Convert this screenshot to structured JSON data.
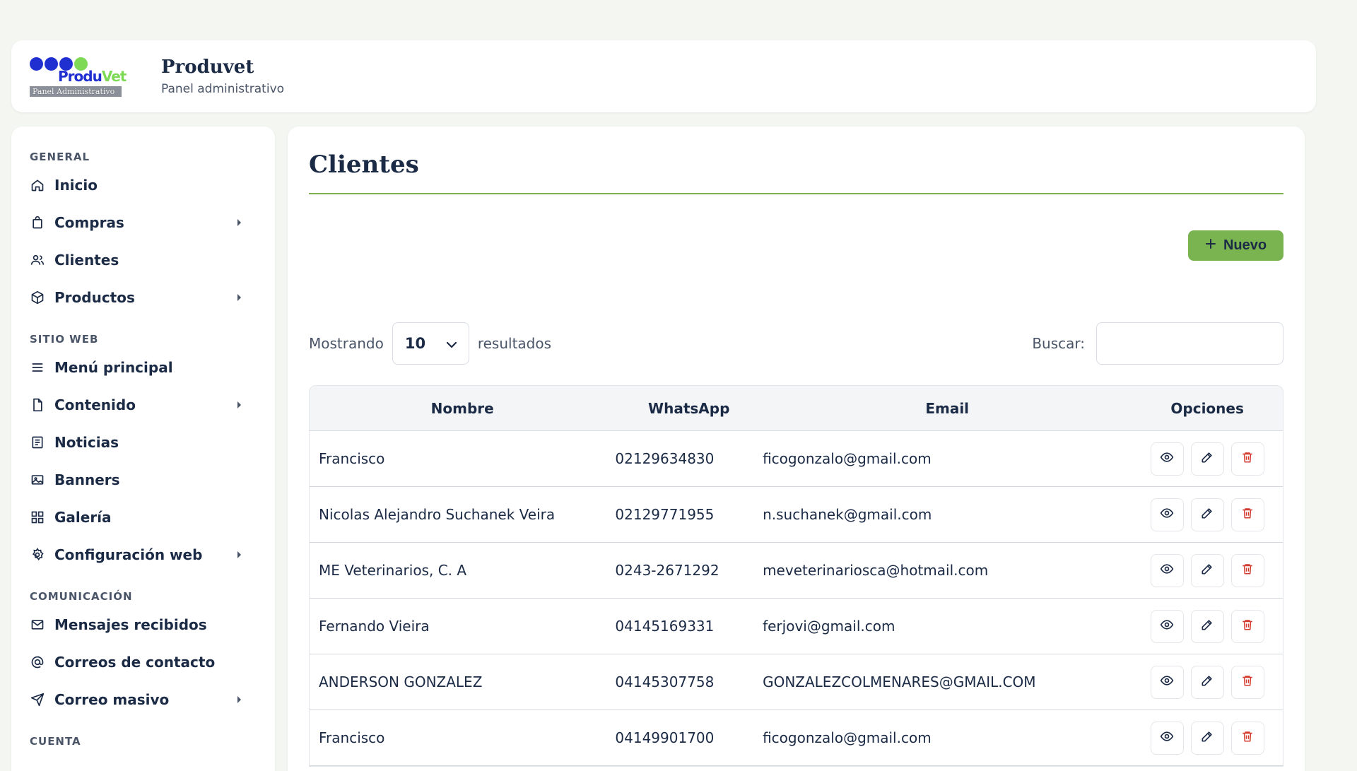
{
  "brand": {
    "title": "Produvet",
    "subtitle": "Panel administrativo",
    "logo_word_a": "Produ",
    "logo_word_b": "Vet",
    "logo_tagline": "Panel Administrativo",
    "colors": {
      "logo_blue": "#1f2fd0",
      "logo_green": "#7ed957",
      "accent": "#7ab450"
    }
  },
  "sidebar": {
    "sections": [
      {
        "label": "GENERAL",
        "items": [
          {
            "label": "Inicio",
            "icon": "home-icon",
            "submenu": false
          },
          {
            "label": "Compras",
            "icon": "bag-icon",
            "submenu": true
          },
          {
            "label": "Clientes",
            "icon": "users-icon",
            "submenu": false
          },
          {
            "label": "Productos",
            "icon": "box-icon",
            "submenu": true
          }
        ]
      },
      {
        "label": "SITIO WEB",
        "items": [
          {
            "label": "Menú principal",
            "icon": "menu-icon",
            "submenu": false
          },
          {
            "label": "Contenido",
            "icon": "file-icon",
            "submenu": true
          },
          {
            "label": "Noticias",
            "icon": "news-icon",
            "submenu": false
          },
          {
            "label": "Banners",
            "icon": "image-icon",
            "submenu": false
          },
          {
            "label": "Galería",
            "icon": "grid-icon",
            "submenu": false
          },
          {
            "label": "Configuración web",
            "icon": "gear-icon",
            "submenu": true
          }
        ]
      },
      {
        "label": "COMUNICACIÓN",
        "items": [
          {
            "label": "Mensajes recibidos",
            "icon": "mail-icon",
            "submenu": false
          },
          {
            "label": "Correos de contacto",
            "icon": "at-icon",
            "submenu": false
          },
          {
            "label": "Correo masivo",
            "icon": "send-icon",
            "submenu": true
          }
        ]
      },
      {
        "label": "CUENTA",
        "items": []
      }
    ]
  },
  "main": {
    "title": "Clientes",
    "new_button": "Nuevo",
    "length_prefix": "Mostrando",
    "length_value": "10",
    "length_suffix": "resultados",
    "search_label": "Buscar:",
    "search_value": "",
    "columns": [
      "Nombre",
      "WhatsApp",
      "Email",
      "Opciones"
    ],
    "rows": [
      {
        "name": "Francisco",
        "whatsapp": "02129634830",
        "email": "ficogonzalo@gmail.com"
      },
      {
        "name": "Nicolas Alejandro Suchanek Veira",
        "whatsapp": "02129771955",
        "email": "n.suchanek@gmail.com"
      },
      {
        "name": "ME Veterinarios, C. A",
        "whatsapp": "0243-2671292",
        "email": "meveterinariosca@hotmail.com"
      },
      {
        "name": "Fernando Vieira",
        "whatsapp": "04145169331",
        "email": "ferjovi@gmail.com"
      },
      {
        "name": "ANDERSON GONZALEZ",
        "whatsapp": "04145307758",
        "email": "GONZALEZCOLMENARES@GMAIL.COM"
      },
      {
        "name": "Francisco",
        "whatsapp": "04149901700",
        "email": "ficogonzalo@gmail.com"
      }
    ]
  }
}
